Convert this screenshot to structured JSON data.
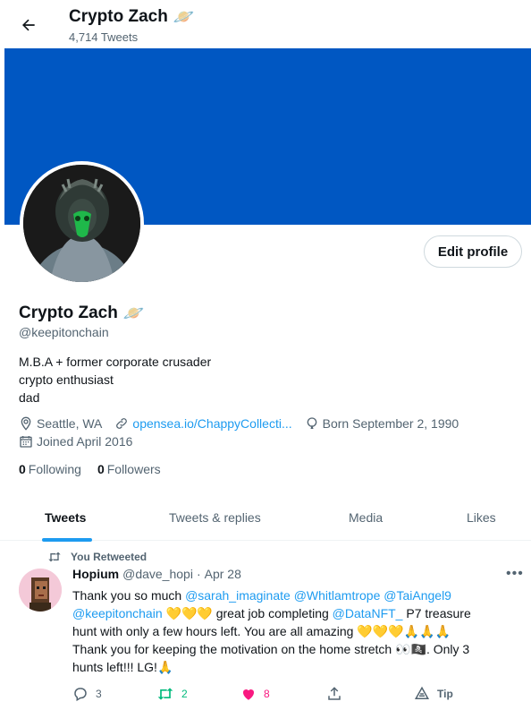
{
  "header": {
    "name": "Crypto Zach",
    "name_emoji": "🪐",
    "tweet_count": "4,714 Tweets"
  },
  "profile": {
    "edit_label": "Edit profile",
    "name": "Crypto Zach",
    "name_emoji": "🪐",
    "handle": "@keepitonchain",
    "bio": [
      "M.B.A + former corporate crusader",
      "crypto enthusiast",
      "dad"
    ],
    "location": "Seattle, WA",
    "website": "opensea.io/ChappyCollecti...",
    "birthday": "Born September 2, 1990",
    "joined": "Joined April 2016",
    "following_count": "0",
    "following_label": "Following",
    "followers_count": "0",
    "followers_label": "Followers"
  },
  "tabs": [
    {
      "label": "Tweets"
    },
    {
      "label": "Tweets & replies"
    },
    {
      "label": "Media"
    },
    {
      "label": "Likes"
    }
  ],
  "tweet": {
    "retweet_label": "You Retweeted",
    "author_name": "Hopium",
    "author_handle": "@dave_hopi",
    "separator": "·",
    "date": "Apr 28",
    "more": "•••",
    "line1": {
      "text": "Thank you so much ",
      "m1": "@sarah_imaginate",
      "m2": "@Whitlamtrope",
      "m3": "@TaiAngel9"
    },
    "line2": {
      "m1": "@keepitonchain",
      "hearts": " 💛💛💛 ",
      "text": "great job completing ",
      "m2": "@DataNFT_",
      "tail": " P7 treasure"
    },
    "line3": "hunt with only a few hours left. You are all amazing 💛💛💛🙏🙏🙏",
    "line4": "Thank you for keeping the motivation on the home stretch 👀🏴‍☠️. Only 3",
    "line5": "hunts left!!! LG!🙏",
    "replies": "3",
    "retweets": "2",
    "likes": "8",
    "tip_label": "Tip"
  },
  "colors": {
    "banner": "#0057c2",
    "accent": "#1d9bf0",
    "retweet": "#00ba7c",
    "like": "#f91880"
  }
}
